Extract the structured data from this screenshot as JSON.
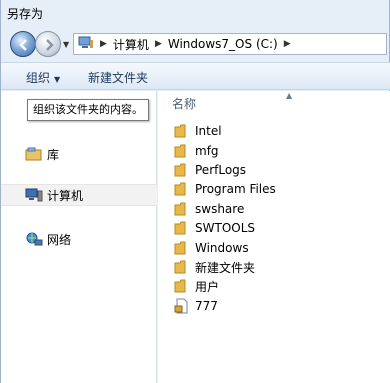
{
  "window": {
    "title": "另存为"
  },
  "address": {
    "segments": [
      "计算机",
      "Windows7_OS (C:)"
    ]
  },
  "toolbar": {
    "organize_label": "组织",
    "new_folder_label": "新建文件夹"
  },
  "tooltip": {
    "text": "组织该文件夹的内容。"
  },
  "nav": {
    "items": [
      {
        "label": "库",
        "icon": "library-icon"
      },
      {
        "label": "计算机",
        "icon": "computer-icon"
      },
      {
        "label": "网络",
        "icon": "network-icon"
      }
    ]
  },
  "files": {
    "column_header": "名称",
    "items": [
      {
        "name": "Intel",
        "type": "folder"
      },
      {
        "name": "mfg",
        "type": "folder"
      },
      {
        "name": "PerfLogs",
        "type": "folder"
      },
      {
        "name": "Program Files",
        "type": "folder"
      },
      {
        "name": "swshare",
        "type": "folder"
      },
      {
        "name": "SWTOOLS",
        "type": "folder"
      },
      {
        "name": "Windows",
        "type": "folder"
      },
      {
        "name": "新建文件夹",
        "type": "folder"
      },
      {
        "name": "用户",
        "type": "folder"
      },
      {
        "name": "777",
        "type": "file"
      }
    ]
  },
  "colors": {
    "window_bg": "#e6eef8",
    "toolbar_text": "#1e395b",
    "folder": "#e8b84a"
  }
}
